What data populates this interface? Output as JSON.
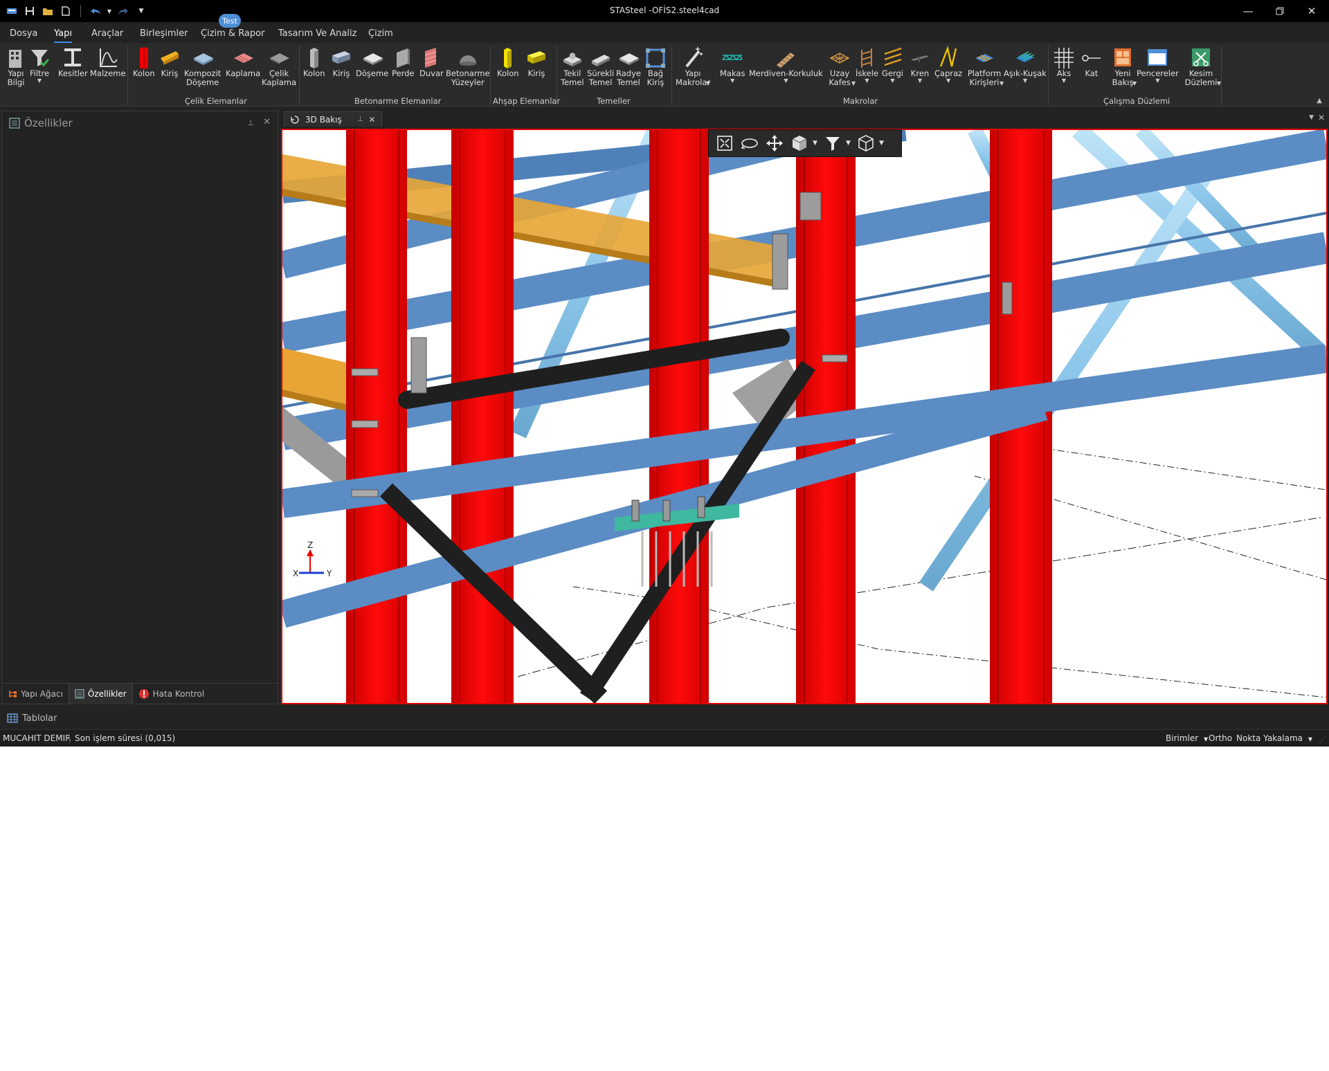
{
  "window": {
    "title": "STASteel -OFİS2.steel4cad",
    "minimize_icon": "minimize-icon",
    "restore_icon": "restore-icon",
    "close_icon": "close-icon"
  },
  "menu": {
    "tabs": [
      "Dosya",
      "Yapı",
      "Araçlar",
      "Birleşimler",
      "Çizim & Rapor",
      "Tasarım Ve Analiz",
      "Çizim"
    ],
    "active": "Yapı",
    "badge": "Test"
  },
  "ribbon": {
    "groups": {
      "cap_celik": "Çelik Elemanlar",
      "cap_betonarme": "Betonarme Elemanlar",
      "cap_ahsap": "Ahşap Elemanlar",
      "cap_temeller": "Temeller",
      "cap_makrolar": "Makrolar",
      "cap_calisma": "Çalışma Düzlemi"
    },
    "yapi_bilgi": "Yapı\nBilgi",
    "filtre": "Filtre",
    "kesitler": "Kesitler",
    "malzeme": "Malzeme",
    "kolon": "Kolon",
    "kiris": "Kiriş",
    "kompozit": "Kompozit\nDöşeme",
    "kaplama": "Kaplama",
    "celik_kaplama": "Çelik\nKaplama",
    "b_kolon": "Kolon",
    "b_kiris": "Kiriş",
    "doseme": "Döşeme",
    "perde": "Perde",
    "duvar": "Duvar",
    "betonarme_yuzeyler": "Betonarme\nYüzeyler",
    "a_kolon": "Kolon",
    "a_kiris": "Kiriş",
    "tekil_temel": "Tekil\nTemel",
    "surekli_temel": "Sürekli\nTemel",
    "radye_temel": "Radye\nTemel",
    "bag_kiris": "Bağ\nKiriş",
    "yapi_makrolar": "Yapı\nMakrolar",
    "makas": "Makas",
    "merdiven": "Merdiven-Korkuluk",
    "uzay_kafes": "Uzay\nKafes",
    "iskele": "İskele",
    "gergi": "Gergi",
    "kren": "Kren",
    "capraz": "Çapraz",
    "platform": "Platform\nKirişleri",
    "asik_kusak": "Aşık-Kuşak",
    "aks": "Aks",
    "kat": "Kat",
    "yeni_bakis": "Yeni\nBakış",
    "pencereler": "Pencereler",
    "kesim_duzlemi": "Kesim\nDüzlemi"
  },
  "properties_panel": {
    "title": "Özellikler",
    "tabs": [
      "Yapı Ağacı",
      "Özellikler",
      "Hata Kontrol"
    ],
    "active_tab": "Özellikler"
  },
  "viewport": {
    "tab_label": "3D Bakış",
    "axis_z": "Z",
    "axis_x": "X",
    "axis_y": "Y",
    "colors": {
      "column": "#ee0000",
      "beam_blue": "#5b8cc4",
      "beam_orange": "#e0a030",
      "brace": "#222222",
      "tube": "#9fd0ee",
      "plate": "#a0a0a0"
    }
  },
  "tables": {
    "label": "Tablolar"
  },
  "status": {
    "user": "MUCAHIT DEMIR",
    "last_op": "Son işlem süresi (0,015)",
    "units": "Birimler",
    "ortho": "Ortho",
    "snap": "Nokta Yakalama"
  }
}
